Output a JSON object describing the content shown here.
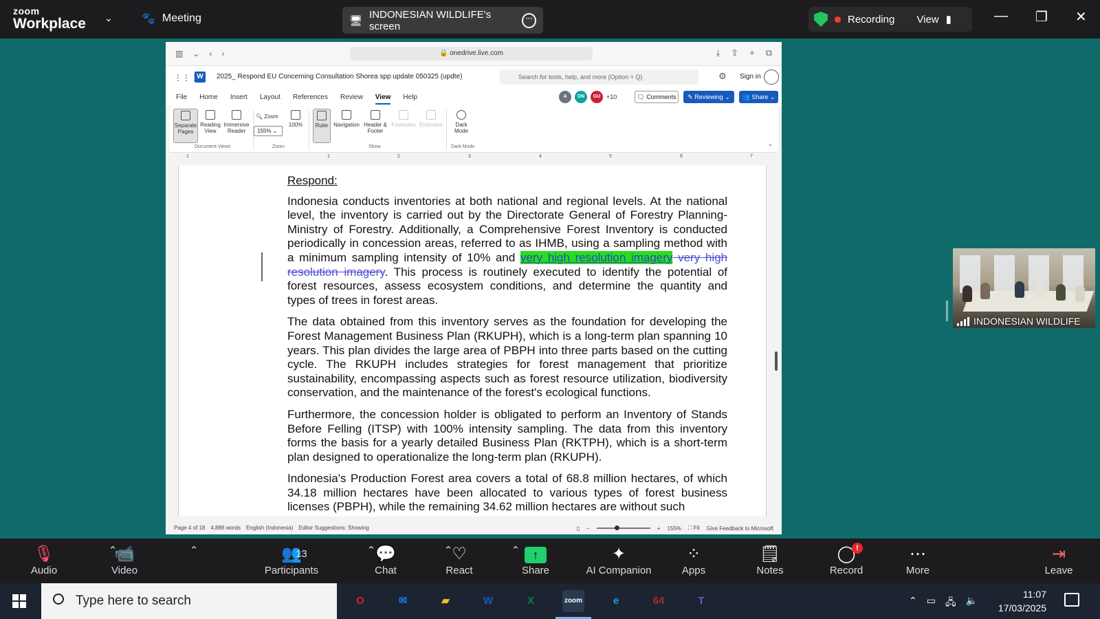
{
  "zoom": {
    "logo_top": "zoom",
    "logo_bottom": "Workplace",
    "meeting_label": "Meeting",
    "screen_label": "INDONESIAN WILDLIFE's screen",
    "recording_label": "Recording",
    "view_label": "View",
    "participant_name": "INDONESIAN WILDLIFE",
    "toolbar": {
      "audio": "Audio",
      "video": "Video",
      "participants": "Participants",
      "participants_count": "13",
      "chat": "Chat",
      "react": "React",
      "share": "Share",
      "ai_companion": "AI Companion",
      "apps": "Apps",
      "notes": "Notes",
      "record": "Record",
      "more": "More",
      "leave": "Leave"
    }
  },
  "browser": {
    "url": "onedrive.live.com"
  },
  "word": {
    "doc_name": "2025_ Respond EU Concerning Consultation Shorea spp update 050325 (updte)",
    "search_placeholder": "Search for tools, help, and more (Option + Q)",
    "sign_in": "Sign in",
    "menu": [
      "File",
      "Home",
      "Insert",
      "Layout",
      "References",
      "Review",
      "View",
      "Help"
    ],
    "active_menu": "View",
    "collaborators": [
      {
        "initials": "A",
        "color": "#6b7280"
      },
      {
        "initials": "DN",
        "color": "#0ea5a0"
      },
      {
        "initials": "GU",
        "color": "#c81e3a"
      }
    ],
    "more_collaborators": "+10",
    "comments": "Comments",
    "reviewing": "Reviewing",
    "share": "Share",
    "ribbon": {
      "separate_pages": "Separate Pages",
      "reading_view": "Reading View",
      "immersive_reader": "Immersive Reader",
      "group_document_views": "Document Views",
      "zoom_label": "Zoom",
      "zoom_value": "155%",
      "hundred": "100%",
      "group_zoom": "Zoom",
      "ruler": "Ruler",
      "navigation": "Navigation",
      "header_footer": "Header & Footer",
      "footnotes": "Footnotes",
      "endnotes": "Endnotes",
      "group_show": "Show",
      "dark_mode": "Dark Mode",
      "group_dark_mode": "Dark Mode"
    },
    "ruler_numbers": [
      "1",
      "1",
      "2",
      "3",
      "4",
      "5",
      "6",
      "7"
    ],
    "document": {
      "heading": "Respond:",
      "p1_a": "Indonesia conducts inventories at both national and regional levels. At the national level, the inventory is carried out by the Directorate General of Forestry Planning-Ministry of Forestry. Additionally, a Comprehensive Forest Inventory is conducted periodically in concession areas, referred to as IHMB, using a sampling method with a minimum sampling intensity of 10% and ",
      "p1_ins": "very high resolution imagery",
      "p1_del": " very high resolution imagery",
      "p1_b": ". This process is routinely executed to identify the potential of forest resources, assess ecosystem conditions, and determine the quantity and types of trees in forest areas.",
      "p2": "The data obtained from this inventory serves as the foundation for developing the Forest Management Business Plan (RKUPH), which is a long-term plan spanning 10 years. This plan divides the large area of PBPH into three parts based on the cutting cycle. The RKUPH includes strategies for forest management that prioritize sustainability, encompassing aspects such as forest resource utilization, biodiversity conservation, and the maintenance of the forest's ecological functions.",
      "p3": "Furthermore, the concession holder is obligated to perform an Inventory of Stands Before Felling (ITSP) with 100% intensity sampling. The data from this inventory forms the basis for a yearly detailed Business Plan (RKTPH), which is a short-term plan designed to operationalize the long-term plan (RKUPH).",
      "p4": "Indonesia's Production Forest area covers a total of 68.8 million hectares, of which 34.18 million hectares have been allocated to various types of forest business licenses (PBPH), while the remaining 34.62 million hectares are without such"
    },
    "status": {
      "page": "Page 4 of 18",
      "words": "4,886 words",
      "language": "English (Indonesia)",
      "editor": "Editor Suggestions: Showing",
      "zoom": "155%",
      "fit": "Fit",
      "feedback": "Give Feedback to Microsoft"
    }
  },
  "taskbar": {
    "search_placeholder": "Type here to search",
    "time": "11:07",
    "date": "17/03/2025",
    "apps": [
      {
        "name": "opera",
        "glyph": "O",
        "color": "#e01f2b"
      },
      {
        "name": "mail",
        "glyph": "✉",
        "color": "#1a73e8"
      },
      {
        "name": "file-explorer",
        "glyph": "▰",
        "color": "#f2b92b"
      },
      {
        "name": "word",
        "glyph": "W",
        "color": "#185abd"
      },
      {
        "name": "excel",
        "glyph": "X",
        "color": "#107c41"
      },
      {
        "name": "zoom",
        "glyph": "zoom",
        "color": "#2d8cff"
      },
      {
        "name": "edge",
        "glyph": "e",
        "color": "#1b9de2"
      },
      {
        "name": "game",
        "glyph": "64",
        "color": "#b3262d"
      },
      {
        "name": "teams",
        "glyph": "T",
        "color": "#5b5fc7"
      }
    ]
  }
}
